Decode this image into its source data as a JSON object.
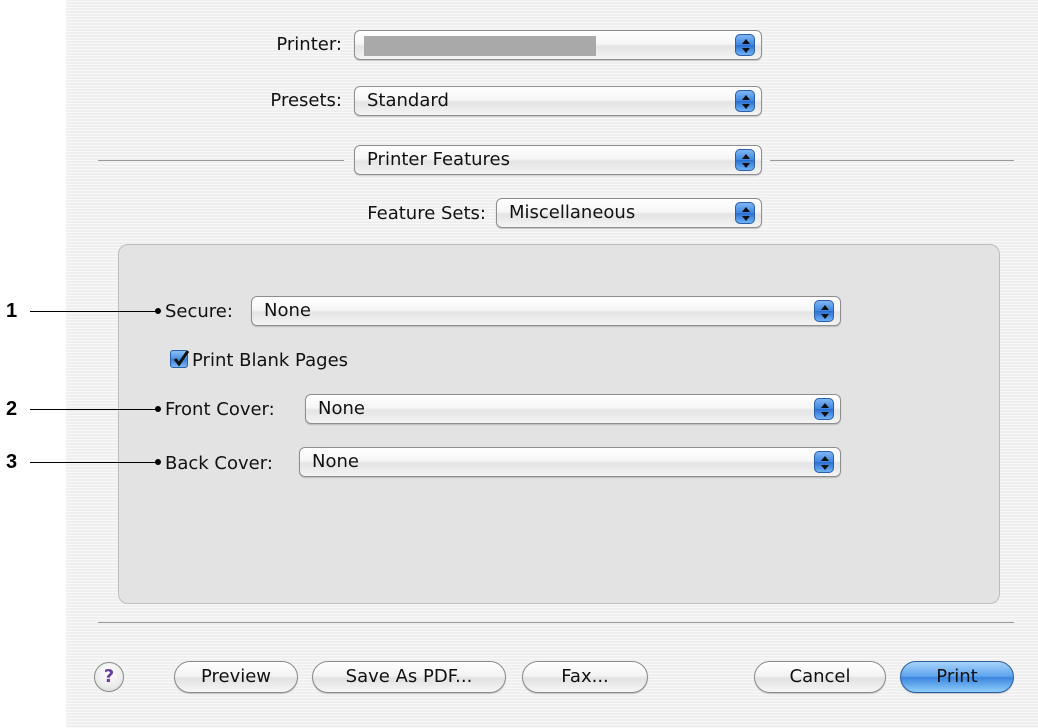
{
  "printer": {
    "label": "Printer:",
    "value": ""
  },
  "presets": {
    "label": "Presets:",
    "value": "Standard"
  },
  "pane_selector": {
    "value": "Printer Features"
  },
  "feature_sets": {
    "label": "Feature Sets:",
    "value": "Miscellaneous"
  },
  "options": {
    "secure": {
      "label": "Secure:",
      "value": "None"
    },
    "print_blank_pages": {
      "label": "Print Blank Pages",
      "checked": true
    },
    "front_cover": {
      "label": "Front Cover:",
      "value": "None"
    },
    "back_cover": {
      "label": "Back Cover:",
      "value": "None"
    }
  },
  "callouts": [
    "1",
    "2",
    "3"
  ],
  "buttons": {
    "help": "?",
    "preview": "Preview",
    "save_as_pdf": "Save As PDF...",
    "fax": "Fax...",
    "cancel": "Cancel",
    "print": "Print"
  },
  "icons": {
    "popup_arrows": "updown-arrows-icon",
    "checkbox": "checkmark-icon",
    "help": "help-icon"
  },
  "colors": {
    "accent": "#3d86e0",
    "dialog_bg": "#efefef",
    "panel_bg": "#e3e3e3"
  }
}
